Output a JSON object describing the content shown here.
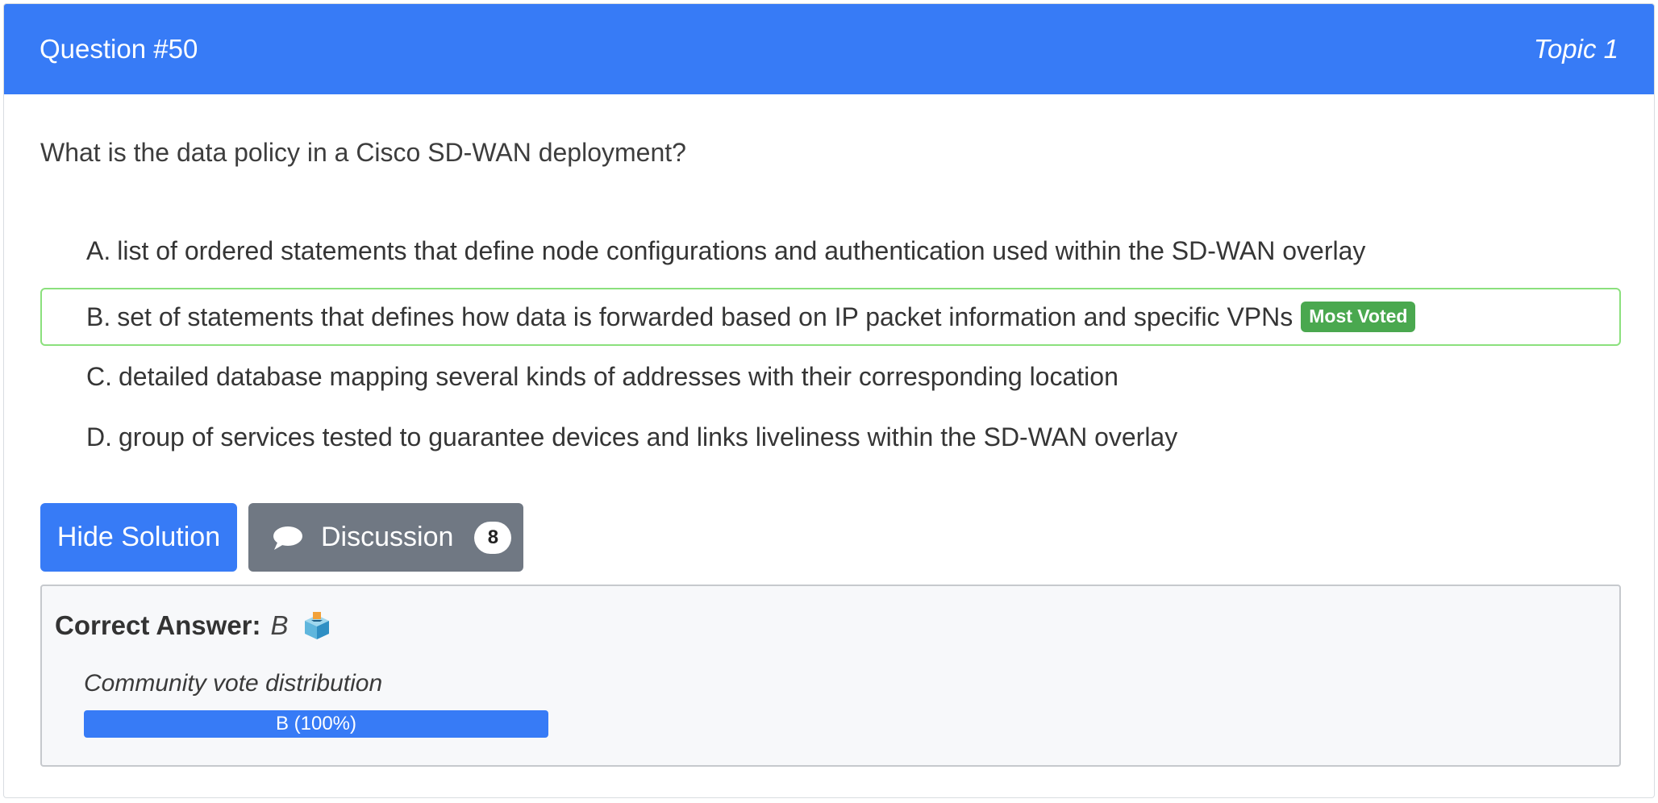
{
  "header": {
    "question_label": "Question #50",
    "topic_label": "Topic 1"
  },
  "question": {
    "text": "What is the data policy in a Cisco SD-WAN deployment?"
  },
  "choices": [
    {
      "letter": "A.",
      "text": "list of ordered statements that define node configurations and authentication used within the SD-WAN overlay",
      "most_voted": false
    },
    {
      "letter": "B.",
      "text": "set of statements that defines how data is forwarded based on IP packet information and specific VPNs",
      "most_voted": true
    },
    {
      "letter": "C.",
      "text": "detailed database mapping several kinds of addresses with their corresponding location",
      "most_voted": false
    },
    {
      "letter": "D.",
      "text": "group of services tested to guarantee devices and links liveliness within the SD-WAN overlay",
      "most_voted": false
    }
  ],
  "badge": {
    "most_voted_label": "Most Voted"
  },
  "buttons": {
    "hide_solution_label": "Hide Solution",
    "discussion_label": "Discussion",
    "discussion_count": "8"
  },
  "answer": {
    "label": "Correct Answer:",
    "value": "B",
    "icon": "ballot-box-icon",
    "distribution_title": "Community vote distribution",
    "bars": [
      {
        "label": "B (100%)",
        "percent": 100
      }
    ]
  },
  "colors": {
    "primary": "#377bf6",
    "secondary": "#707883",
    "success": "#4aa84f",
    "voted_border": "#8be07d"
  }
}
